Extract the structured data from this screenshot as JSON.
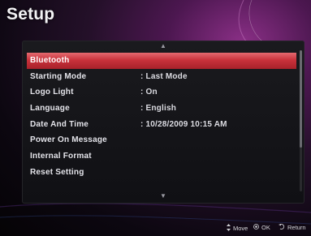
{
  "screen": {
    "title": "Setup"
  },
  "menu": {
    "items": [
      {
        "label": "Bluetooth",
        "value": "",
        "selected": true
      },
      {
        "label": "Starting Mode",
        "value": ": Last Mode",
        "selected": false
      },
      {
        "label": "Logo Light",
        "value": ": On",
        "selected": false
      },
      {
        "label": "Language",
        "value": ": English",
        "selected": false
      },
      {
        "label": "Date And Time",
        "value": ": 10/28/2009 10:15 AM",
        "selected": false
      },
      {
        "label": "Power On Message",
        "value": "",
        "selected": false
      },
      {
        "label": "Internal Format",
        "value": "",
        "selected": false
      },
      {
        "label": "Reset Setting",
        "value": "",
        "selected": false
      }
    ],
    "scroll_up_glyph": "▲",
    "scroll_down_glyph": "▼"
  },
  "footer": {
    "move_label": "Move",
    "ok_label": "OK",
    "return_label": "Return",
    "move_icon": "updown-arrow-icon",
    "ok_icon": "ok-dot-icon",
    "return_icon": "return-arrow-icon"
  },
  "colors": {
    "selected_bar": "#c8323b",
    "panel_bg": "#141418",
    "background_accent": "#8a2f86"
  }
}
